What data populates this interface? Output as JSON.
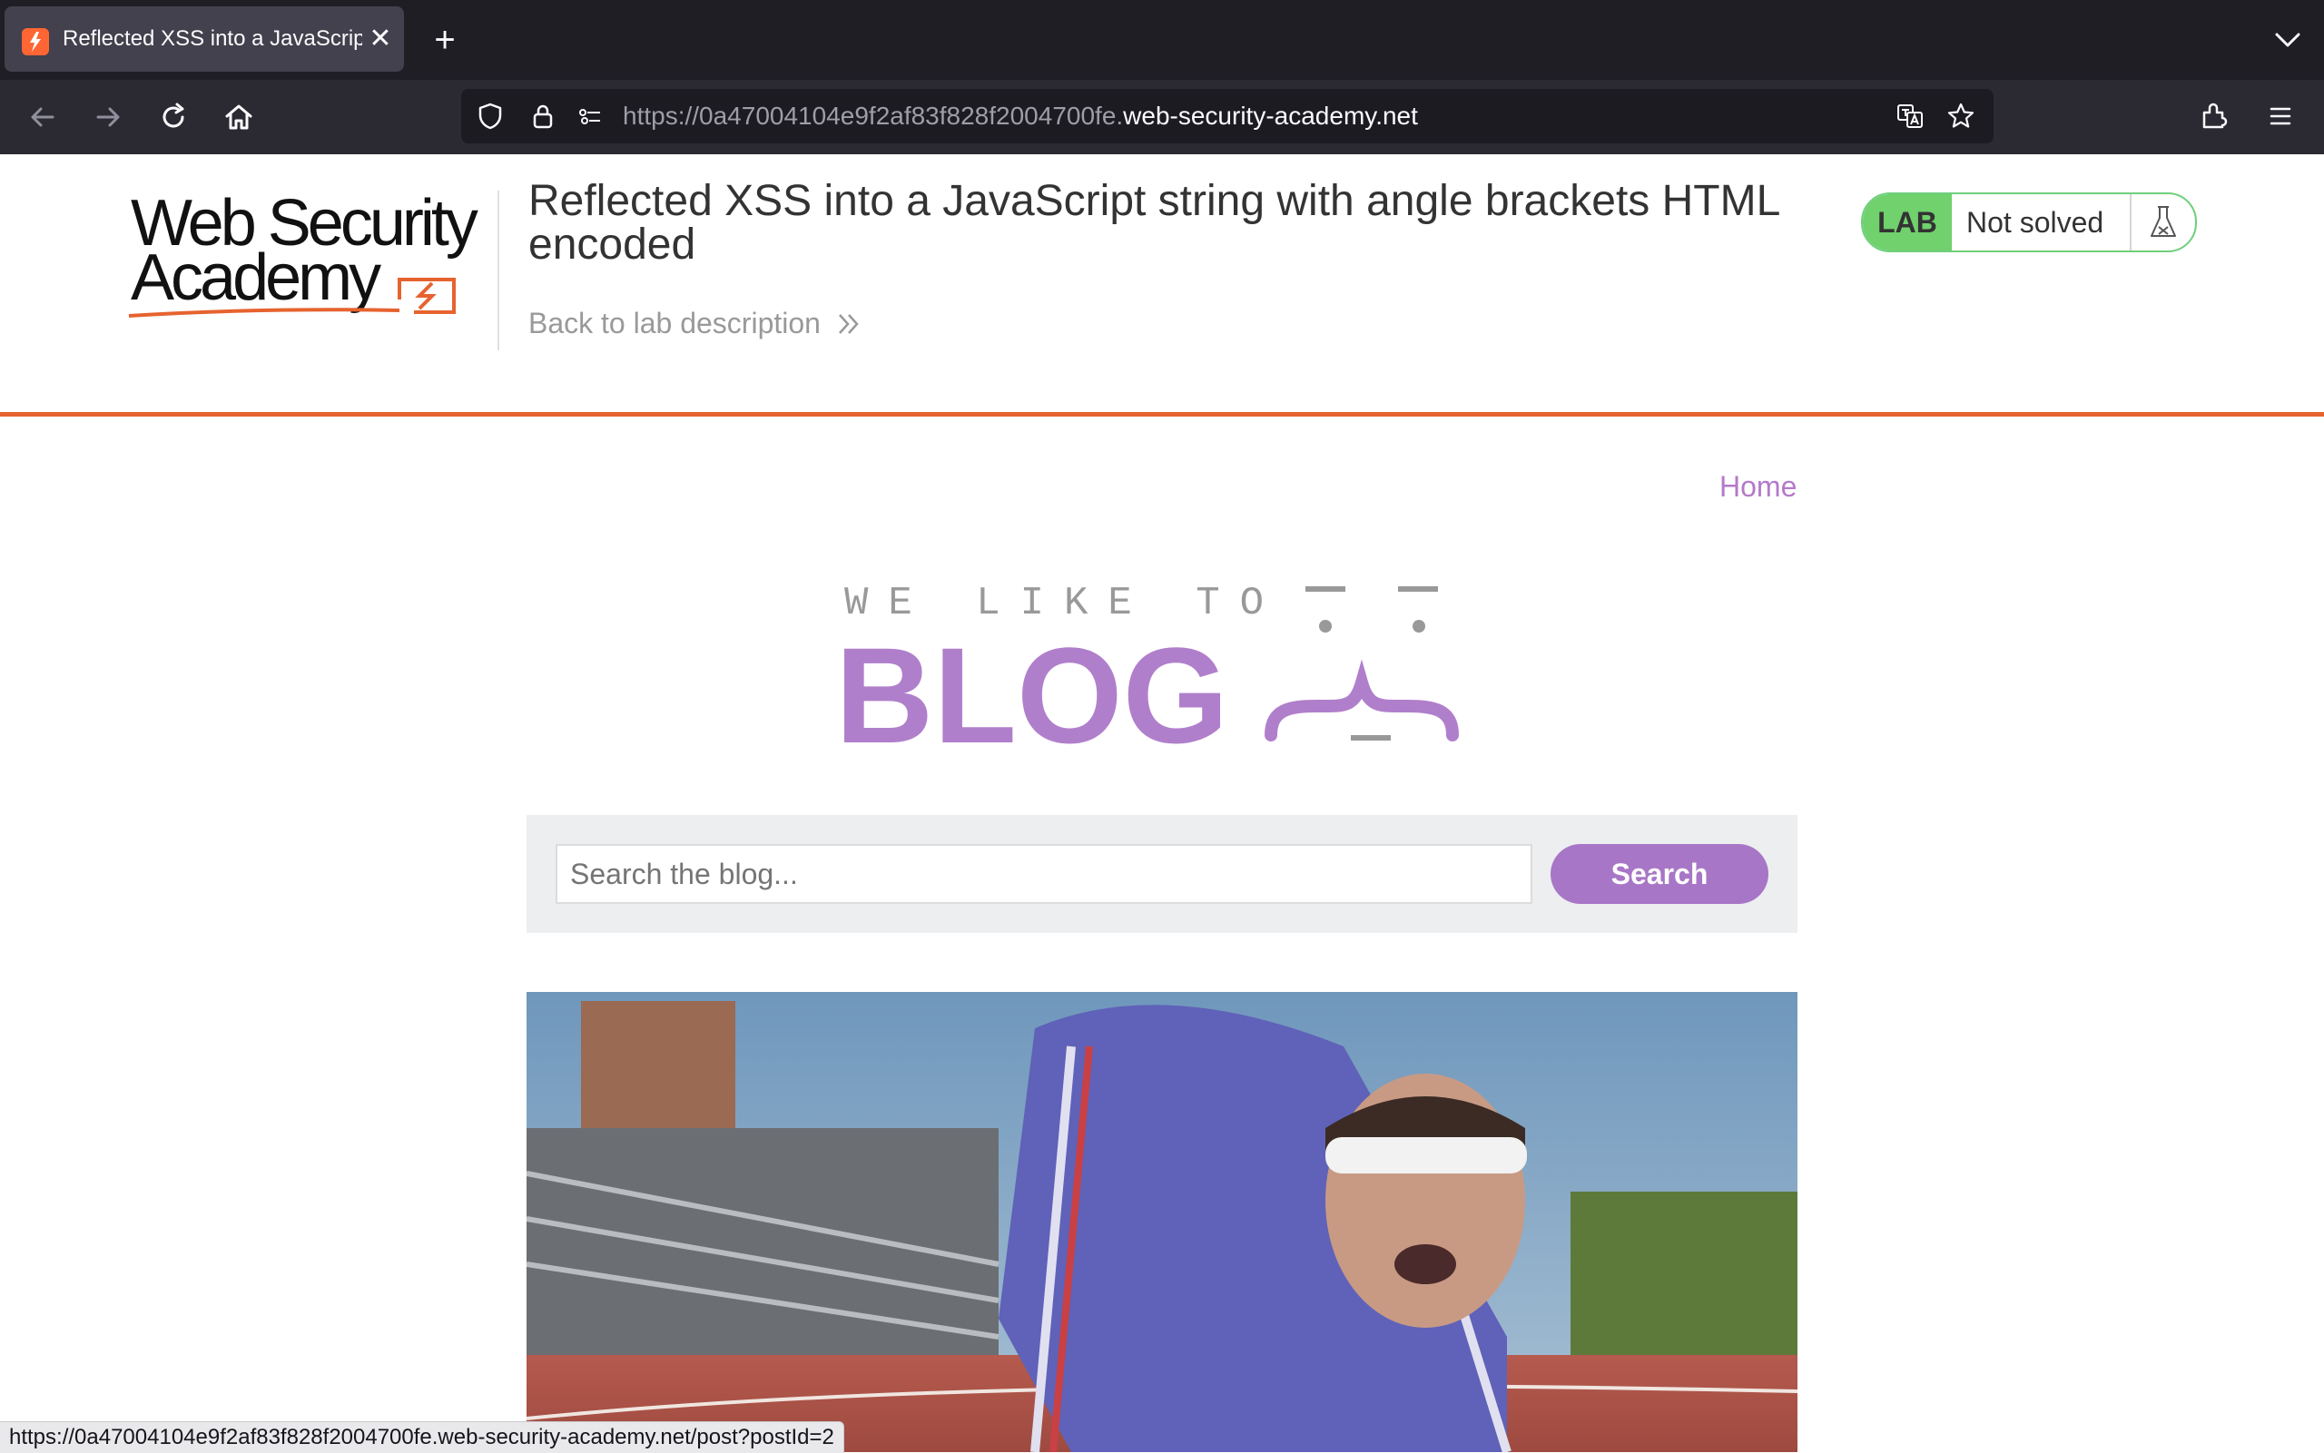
{
  "browser": {
    "tab": {
      "title": "Reflected XSS into a JavaScript string with angle brackets HTML encoded"
    },
    "url": {
      "prefix": "https://0a47004104e9f2af83f828f2004700fe.",
      "host": "web-security-academy.net"
    },
    "status_url": "https://0a47004104e9f2af83f828f2004700fe.web-security-academy.net/post?postId=2"
  },
  "lab_header": {
    "logo_text_line1": "Web Security",
    "logo_text_line2": "Academy",
    "title": "Reflected XSS into a JavaScript string with angle brackets HTML encoded",
    "back_link": "Back to lab description",
    "badge": "LAB",
    "status": "Not solved"
  },
  "blog": {
    "nav_home": "Home",
    "banner_line1": "WE LIKE TO",
    "banner_line2": "BLOG",
    "search": {
      "placeholder": "Search the blog...",
      "button": "Search"
    }
  },
  "colors": {
    "accent_orange": "#e6632f",
    "blog_purple": "#a876c6",
    "lab_green": "#70d16d"
  }
}
